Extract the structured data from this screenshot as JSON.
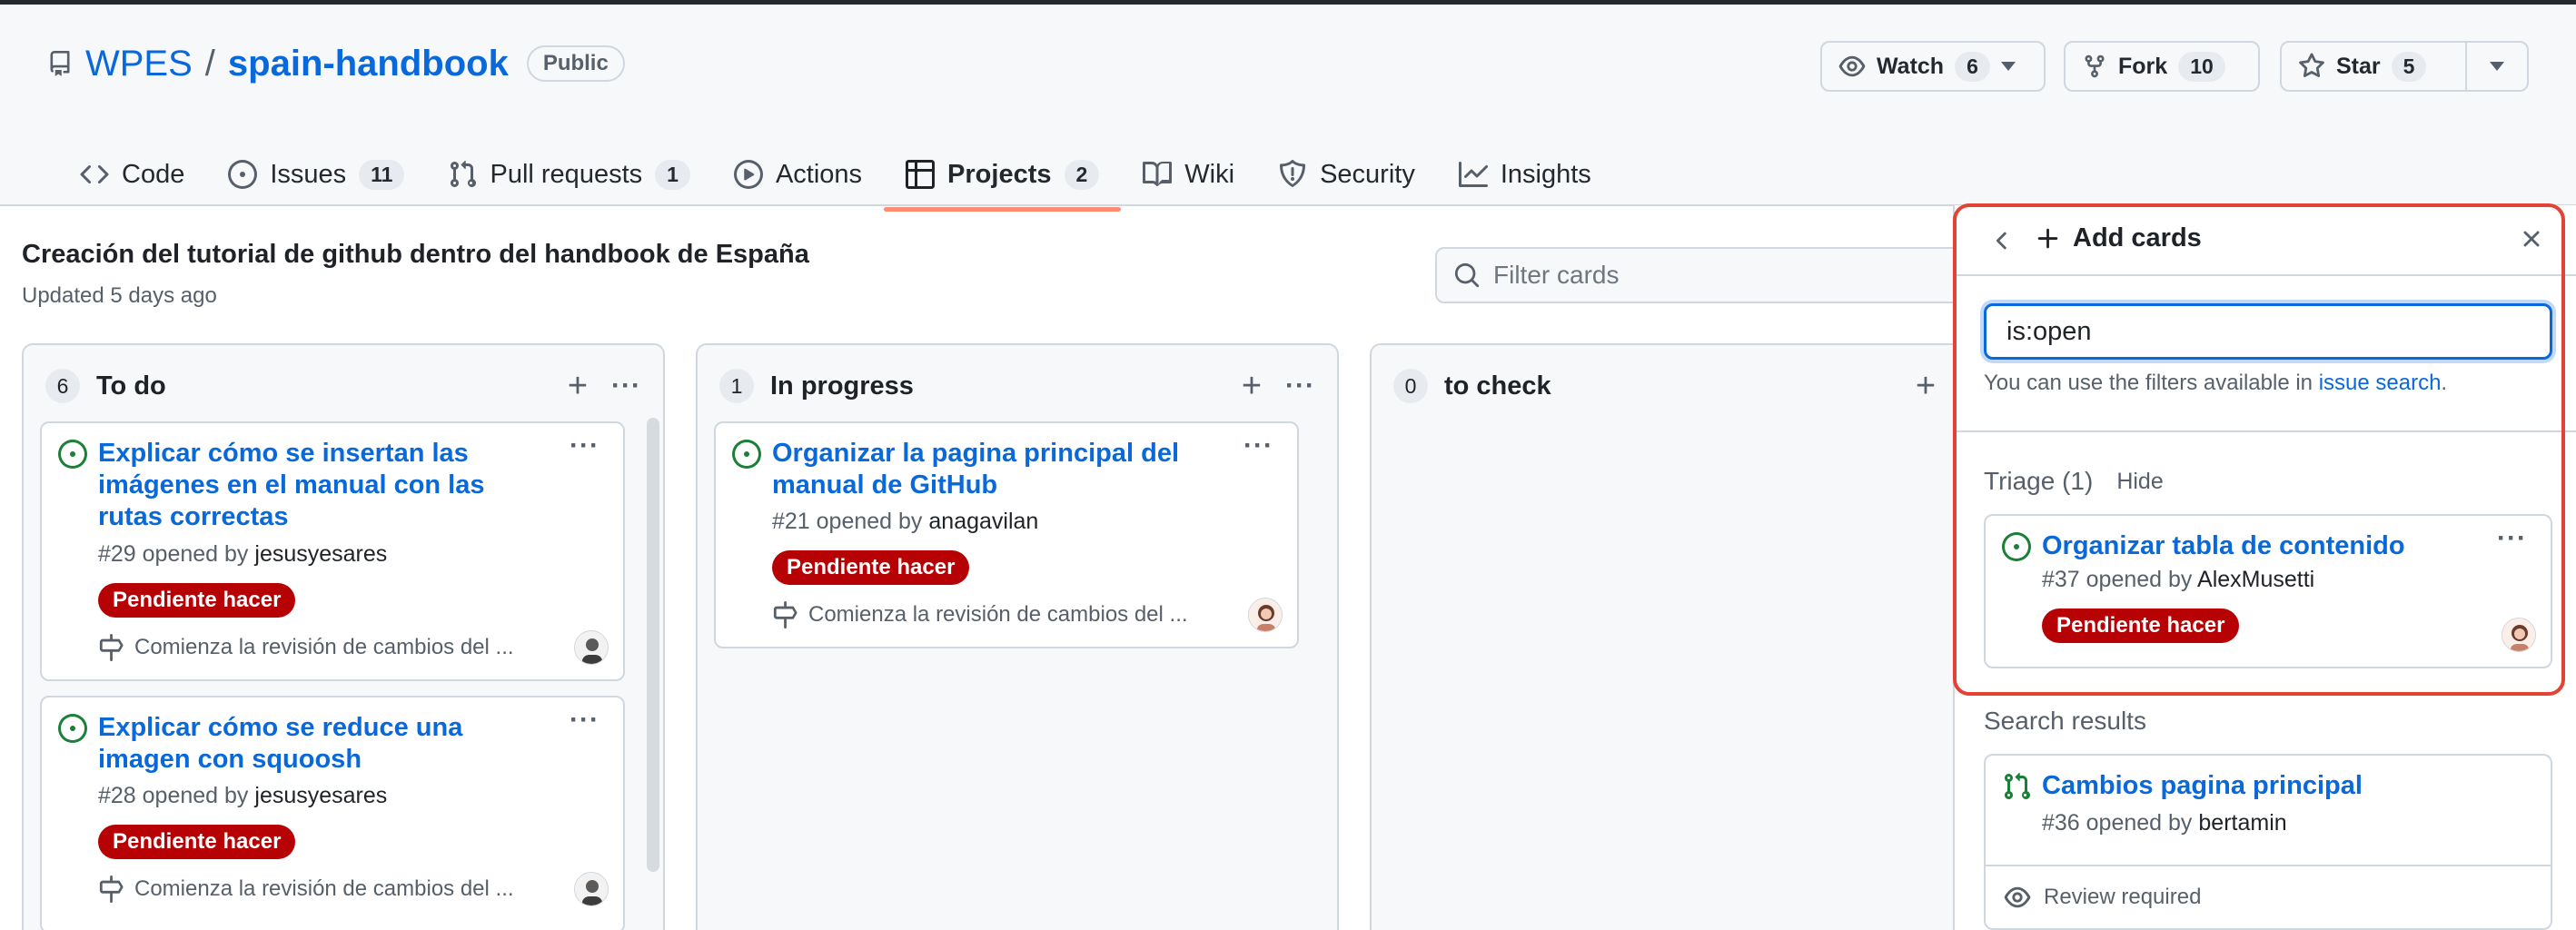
{
  "repo": {
    "owner": "WPES",
    "separator": "/",
    "name": "spain-handbook",
    "visibility": "Public",
    "watch_label": "Watch",
    "watch_count": "6",
    "fork_label": "Fork",
    "fork_count": "10",
    "star_label": "Star",
    "star_count": "5"
  },
  "tabs": [
    {
      "label": "Code",
      "count": ""
    },
    {
      "label": "Issues",
      "count": "11"
    },
    {
      "label": "Pull requests",
      "count": "1"
    },
    {
      "label": "Actions",
      "count": ""
    },
    {
      "label": "Projects",
      "count": "2"
    },
    {
      "label": "Wiki",
      "count": ""
    },
    {
      "label": "Security",
      "count": ""
    },
    {
      "label": "Insights",
      "count": ""
    }
  ],
  "project": {
    "title": "Creación del tutorial de github dentro del handbook de España",
    "updated": "Updated 5 days ago",
    "filter_placeholder": "Filter cards"
  },
  "columns": [
    {
      "count": "6",
      "name": "To do",
      "cards": [
        {
          "title": "Explicar cómo se insertan las imágenes en el manual con las rutas correctas",
          "number": "#29 opened by",
          "author": "jesusyesares",
          "label": "Pendiente hacer",
          "milestone": "Comienza la revisión de cambios del ..."
        },
        {
          "title": "Explicar cómo se reduce una imagen con squoosh",
          "number": "#28 opened by",
          "author": "jesusyesares",
          "label": "Pendiente hacer",
          "milestone": "Comienza la revisión de cambios del ..."
        }
      ]
    },
    {
      "count": "1",
      "name": "In progress",
      "cards": [
        {
          "title": "Organizar la pagina principal del manual de GitHub",
          "number": "#21 opened by",
          "author": "anagavilan",
          "label": "Pendiente hacer",
          "milestone": "Comienza la revisión de cambios del ..."
        }
      ]
    },
    {
      "count": "0",
      "name": "to check",
      "cards": []
    }
  ],
  "panel": {
    "title": "Add cards",
    "search_value": "is:open",
    "hint_prefix": "You can use the filters available in",
    "hint_link": "issue search",
    "hint_suffix": ".",
    "triage_label": "Triage (1)",
    "hide_label": "Hide",
    "triage_card": {
      "title": "Organizar tabla de contenido",
      "number": "#37 opened by",
      "author": "AlexMusetti",
      "label": "Pendiente hacer"
    },
    "search_results_label": "Search results",
    "result_card": {
      "title": "Cambios pagina principal",
      "number": "#36 opened by",
      "author": "bertamin",
      "status": "Review required"
    }
  },
  "colors": {
    "link": "#0969da",
    "label_bg": "#b60205",
    "open_issue": "#1a7f37",
    "highlight": "#e34234",
    "tab_underline": "#fd8c73"
  }
}
